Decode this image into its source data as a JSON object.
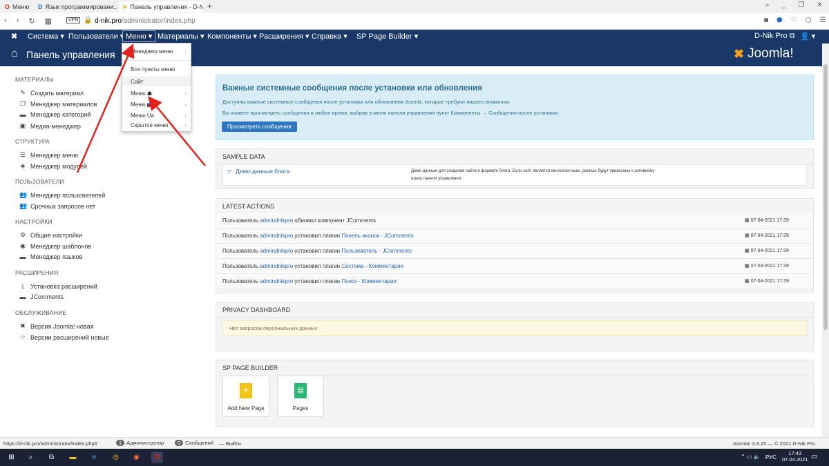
{
  "browser": {
    "tabs": [
      {
        "title": "Меню"
      },
      {
        "title": "Язык программировани..."
      },
      {
        "title": "Панель управления - D-N..."
      }
    ],
    "address": {
      "domain": "d-nik.pro",
      "path": "/administrator/index.php",
      "vpn": "VPN"
    }
  },
  "topnav": {
    "items": [
      "Система",
      "Пользователи",
      "Меню",
      "Материалы",
      "Компоненты",
      "Расширения",
      "Справка",
      "SP Page Builder"
    ],
    "user": "D-Nik Pro"
  },
  "header": {
    "title": "Панель управления",
    "brand": "Joomla!"
  },
  "sidebar": {
    "sections": [
      {
        "title": "МАТЕРИАЛЫ",
        "items": [
          "Создать материал",
          "Менеджер материалов",
          "Менеджер категорий",
          "Медиа-менеджер"
        ]
      },
      {
        "title": "СТРУКТУРА",
        "items": [
          "Менеджер меню",
          "Менеджер модулей"
        ]
      },
      {
        "title": "ПОЛЬЗОВАТЕЛИ",
        "items": [
          "Менеджер пользователей",
          "Срочных запросов нет"
        ]
      },
      {
        "title": "НАСТРОЙКИ",
        "items": [
          "Общие настройки",
          "Менеджер шаблонов",
          "Менеджер языков"
        ]
      },
      {
        "title": "РАСШИРЕНИЯ",
        "items": [
          "Установка расширений",
          "JComments"
        ]
      },
      {
        "title": "ОБСЛУЖИВАНИЕ",
        "items": [
          "Версия Joomla! новая",
          "Версии расширений новые"
        ]
      }
    ]
  },
  "dropdown": {
    "items": [
      "Менеджер меню",
      "Все пункты меню",
      "Сайт",
      "Меню",
      "Меню",
      "Меню Ua",
      "Скрытое меню"
    ]
  },
  "postinstall": {
    "title": "Важные системные сообщения после установки или обновления",
    "line1": "Доступны важные системные сообщения после установки или обновления Joomla, которые требуют вашего внимания.",
    "line2": "Вы можете просмотреть сообщения в любое время, выбрав в меню панели управления пункт Компоненты → Сообщения после установки.",
    "button": "Просмотреть сообщения"
  },
  "sample": {
    "title": "SAMPLE DATA",
    "item": "Демо-данные блога",
    "desc1": "Демо-данные для создания сайта в формате блога. Если сайт является многоязычным, данные будут привязаны к активному",
    "desc2": "языку панели управления."
  },
  "latest": {
    "title": "LATEST ACTIONS",
    "rows": [
      {
        "pre": "Пользователь",
        "user": "admindnikpro",
        "mid": "обновил компонент JComments",
        "link": "",
        "date": "07-04-2021 17:39"
      },
      {
        "pre": "Пользователь",
        "user": "admindnikpro",
        "mid": "установил плагин",
        "link": "Панель иконок - JComments",
        "date": "07-04-2021 17:39"
      },
      {
        "pre": "Пользователь",
        "user": "admindnikpro",
        "mid": "установил плагин",
        "link": "Пользователь - JComments",
        "date": "07-04-2021 17:39"
      },
      {
        "pre": "Пользователь",
        "user": "admindnikpro",
        "mid": "установил плагин",
        "link": "Система - Комментарии",
        "date": "07-04-2021 17:39"
      },
      {
        "pre": "Пользователь",
        "user": "admindnikpro",
        "mid": "установил плагин",
        "link": "Поиск - Комментарии",
        "date": "07-04-2021 17:39"
      }
    ]
  },
  "privacy": {
    "title": "PRIVACY DASHBOARD",
    "msg": "Нет запросов персональных данных."
  },
  "spb": {
    "title": "SP PAGE BUILDER",
    "add": "Add New Page",
    "pages": "Pages"
  },
  "status": {
    "url": "https://d-nik.pro/administrator/index.php#",
    "admins_count": "1",
    "admins": "Администратор",
    "msgs_count": "0",
    "msgs": "Сообщений",
    "logout": "Выйти",
    "version": "Joomla! 3.9.25 — © 2021 D-Nik Pro"
  },
  "taskbar": {
    "lang": "РУС",
    "time": "17:43",
    "date": "07.04.2021"
  },
  "colors": {
    "nav": "#1a3867",
    "info_bg": "#d9edf7",
    "button": "#2f76c1",
    "arrow": "#e5211c"
  }
}
